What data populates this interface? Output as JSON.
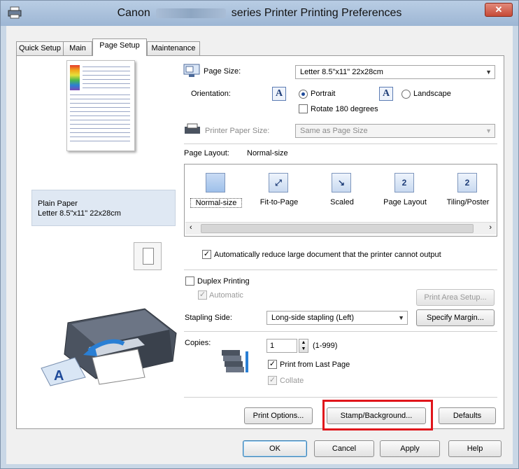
{
  "window": {
    "title_left": "Canon",
    "title_right": "series Printer Printing Preferences",
    "close_label": "✕"
  },
  "tabs": [
    {
      "label": "Quick Setup"
    },
    {
      "label": "Main"
    },
    {
      "label": "Page Setup"
    },
    {
      "label": "Maintenance"
    }
  ],
  "preview": {
    "paper_type": "Plain Paper",
    "paper_size": "Letter 8.5\"x11\" 22x28cm"
  },
  "page_size": {
    "label": "Page Size:",
    "value": "Letter 8.5\"x11\" 22x28cm"
  },
  "orientation": {
    "label": "Orientation:",
    "portrait_label": "Portrait",
    "landscape_label": "Landscape",
    "rotate_label": "Rotate 180 degrees",
    "selected": "Portrait"
  },
  "printer_paper_size": {
    "label": "Printer Paper Size:",
    "value": "Same as Page Size"
  },
  "page_layout": {
    "label": "Page Layout:",
    "current": "Normal-size",
    "items": [
      {
        "label": "Normal-size"
      },
      {
        "label": "Fit-to-Page"
      },
      {
        "label": "Scaled"
      },
      {
        "label": "Page Layout",
        "glyph": "2"
      },
      {
        "label": "Tiling/Poster",
        "glyph": "2"
      }
    ]
  },
  "auto_reduce": {
    "label": "Automatically reduce large document that the printer cannot output",
    "checked": true
  },
  "duplex": {
    "label": "Duplex Printing",
    "automatic_label": "Automatic",
    "print_area_setup_label": "Print Area Setup..."
  },
  "stapling": {
    "label": "Stapling Side:",
    "value": "Long-side stapling (Left)",
    "specify_margin_label": "Specify Margin..."
  },
  "copies": {
    "label": "Copies:",
    "value": "1",
    "range": "(1-999)",
    "print_from_last_label": "Print from Last Page",
    "collate_label": "Collate"
  },
  "panel_buttons": {
    "print_options": "Print Options...",
    "stamp_background": "Stamp/Background...",
    "defaults": "Defaults"
  },
  "dialog_buttons": {
    "ok": "OK",
    "cancel": "Cancel",
    "apply": "Apply",
    "help": "Help"
  },
  "colors": {
    "highlight": "#e0151b",
    "title_bar": "#9db6d4",
    "close_button": "#c64a36"
  }
}
